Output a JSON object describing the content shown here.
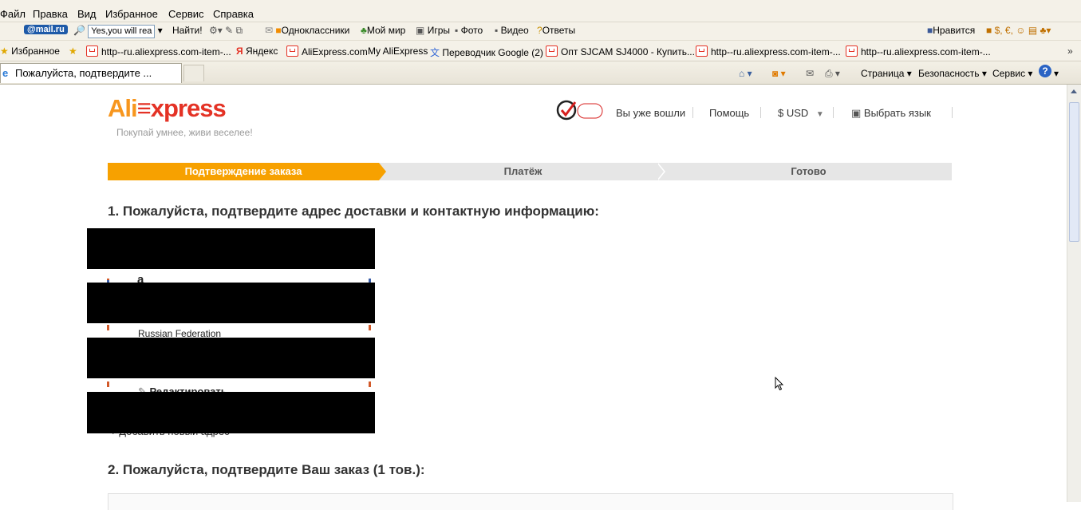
{
  "menubar": {
    "items": [
      "Файл",
      "Правка",
      "Вид",
      "Избранное",
      "Сервис",
      "Справка"
    ]
  },
  "toolbar": {
    "mailru": "@mail.ru",
    "search_value": "Yes,you will rea",
    "find_button": "Найти!",
    "links": [
      "Одноклассники",
      "Мой мир",
      "Игры",
      "Фото",
      "Видео",
      "Ответы"
    ],
    "like": "Нравится"
  },
  "favorites": {
    "label": "Избранное",
    "items": [
      "http--ru.aliexpress.com-item-...",
      "Яндекс",
      "AliExpress.com",
      "My AliExpress",
      "Переводчик Google (2)",
      "Опт SJCAM SJ4000 - Купить...",
      "http--ru.aliexpress.com-item-...",
      "http--ru.aliexpress.com-item-..."
    ]
  },
  "tabbar": {
    "tab_title": "Пожалуйста, подтвердите ...",
    "commands": [
      "Страница",
      "Безопасность",
      "Сервис"
    ]
  },
  "page": {
    "logo_ali": "Ali",
    "logo_express": "xpress",
    "tagline": "Покупай умнее, живи веселее!",
    "header": {
      "logged_in": "Вы уже вошли",
      "help": "Помощь",
      "currency": "$ USD",
      "language": "Выбрать язык"
    },
    "steps": [
      "Подтверждение заказа",
      "Платёж",
      "Готово"
    ],
    "section1_title": "1. Пожалуйста, подтвердите адрес доставки и контактную информацию:",
    "address": {
      "name_fragment": "а",
      "country": "Russian Federation",
      "edit": "Редактировать",
      "add_new": "Добавить новый адрес"
    },
    "section2_title": "2. Пожалуйста, подтвердите Ваш заказ (1 тов.):"
  },
  "colors": {
    "brand_orange": "#f7961e",
    "brand_red": "#e43225",
    "step_active": "#f7a100",
    "step_inactive": "#e6e6e6"
  }
}
